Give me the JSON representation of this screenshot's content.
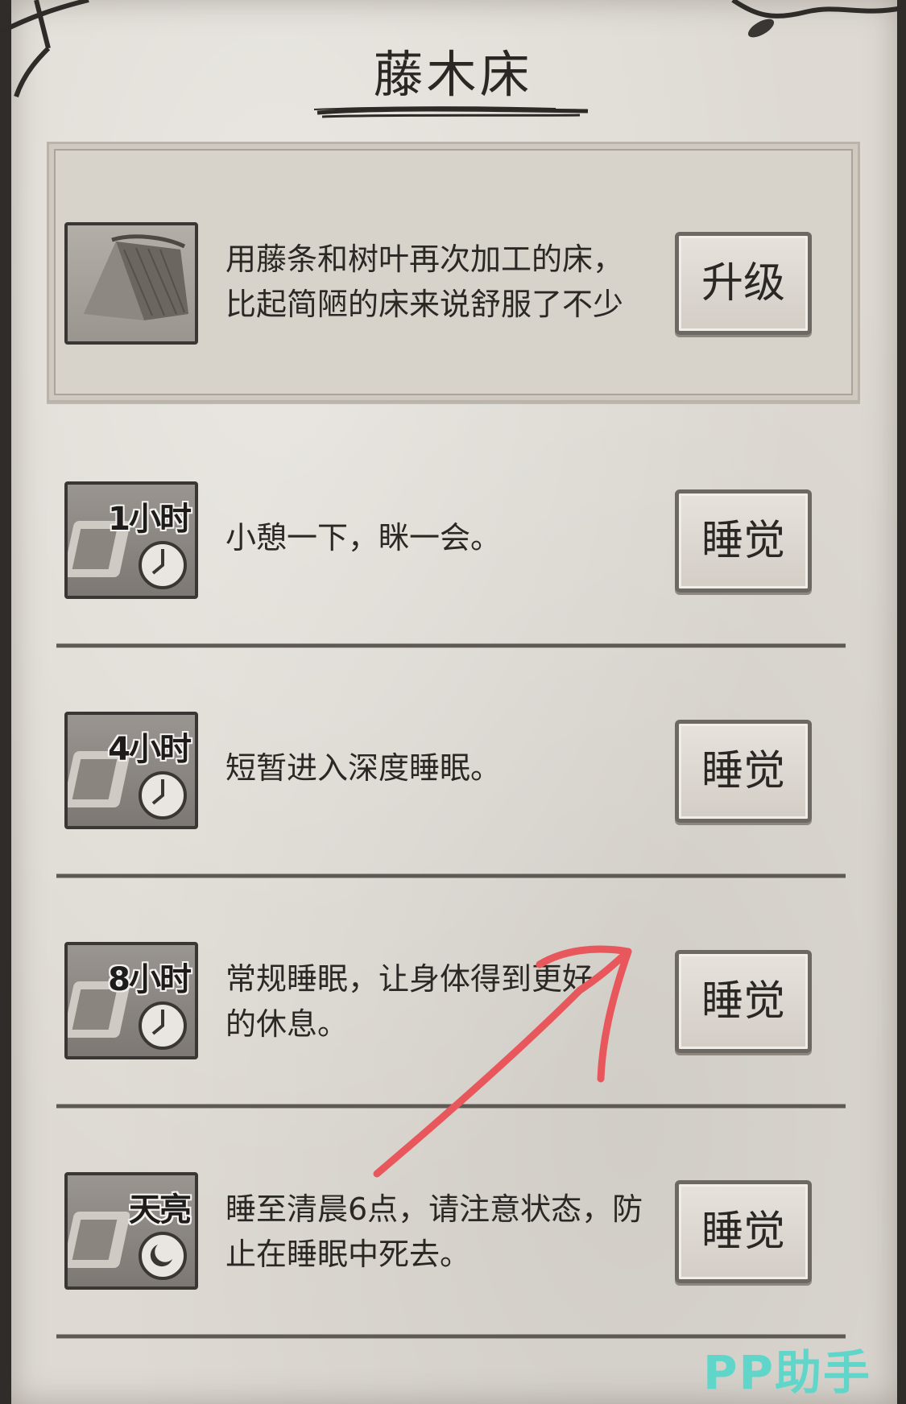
{
  "page": {
    "title": "藤木床"
  },
  "bed_panel": {
    "description": "用藤条和树叶再次加工的床，比起简陋的床来说舒服了不少",
    "upgrade_label": "升级",
    "icon": "thatch-bed-icon"
  },
  "sleep_options": [
    {
      "badge": "1小时",
      "description": "小憩一下，眯一会。",
      "button_label": "睡觉",
      "icon": "clock-icon"
    },
    {
      "badge": "4小时",
      "description": "短暂进入深度睡眠。",
      "button_label": "睡觉",
      "icon": "clock-icon"
    },
    {
      "badge": "8小时",
      "description": "常规睡眠，让身体得到更好的休息。",
      "button_label": "睡觉",
      "icon": "clock-icon"
    },
    {
      "badge": "天亮",
      "description": "睡至清晨6点，请注意状态，防止在睡眠中死去。",
      "button_label": "睡觉",
      "icon": "moon-clock-icon"
    }
  ],
  "watermark": {
    "text": "PP助手"
  },
  "colors": {
    "paper": "#dedad3",
    "ink": "#2a2725",
    "annotation_arrow": "#e8575c",
    "watermark": "#5fd6c9"
  }
}
